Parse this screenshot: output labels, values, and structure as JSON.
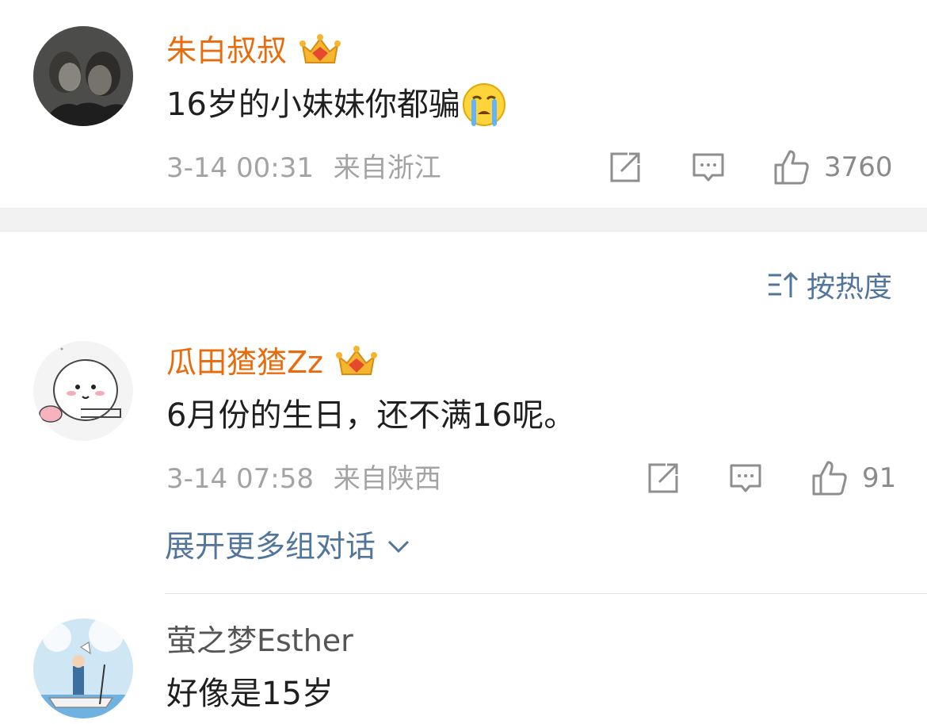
{
  "comments": [
    {
      "username": "朱白叔叔",
      "body": "16岁的小妹妹你都骗",
      "emoji": "crying-face-emoji",
      "time": "3-14 00:31",
      "location": "来自浙江",
      "likes": "3760",
      "vip": true
    },
    {
      "username": "瓜田猹猹Zz",
      "body": "6月份的生日，还不满16呢。",
      "time": "3-14 07:58",
      "location": "来自陕西",
      "likes": "91",
      "vip": true
    },
    {
      "username": "萤之梦Esther",
      "body": "好像是15岁",
      "vip": false
    }
  ],
  "sort": {
    "label": "按热度",
    "icon": "sort-icon"
  },
  "expand": {
    "label": "展开更多组对话",
    "icon": "chevron-down-icon"
  },
  "colors": {
    "vip_name": "#e86b0c",
    "link": "#52759c",
    "meta": "#a3a3a3",
    "crown": "#f5b52e"
  }
}
